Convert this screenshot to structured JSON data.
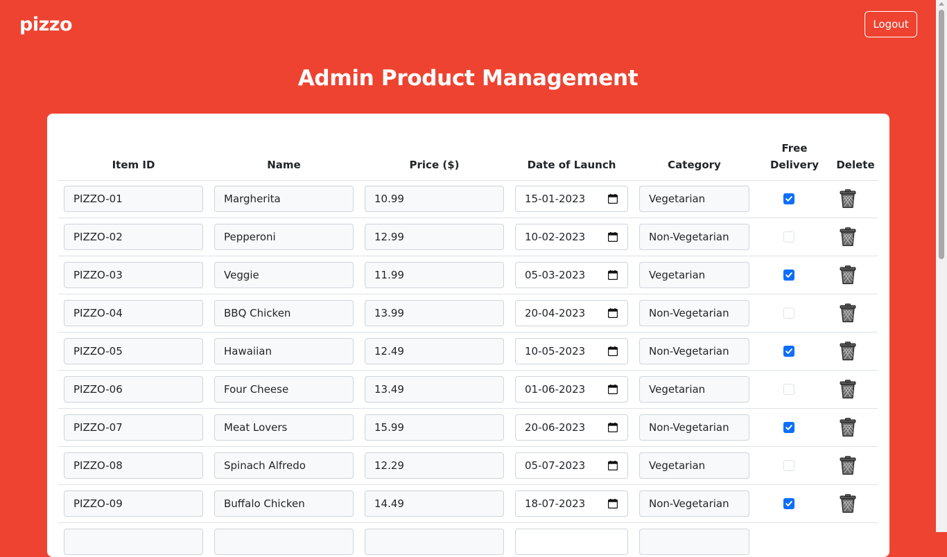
{
  "brand": "pizzo",
  "logout_label": "Logout",
  "page_title": "Admin Product Management",
  "columns": {
    "item_id": "Item ID",
    "name": "Name",
    "price": "Price ($)",
    "date": "Date of Launch",
    "category": "Category",
    "free_delivery": "Free Delivery",
    "delete": "Delete"
  },
  "colors": {
    "header_bg": "#ee4331",
    "checkbox_on": "#0d6efd"
  },
  "products": [
    {
      "id": "PIZZO-01",
      "name": "Margherita",
      "price": "10.99",
      "date": "15-01-2023",
      "category": "Vegetarian",
      "free_delivery": true
    },
    {
      "id": "PIZZO-02",
      "name": "Pepperoni",
      "price": "12.99",
      "date": "10-02-2023",
      "category": "Non-Vegetarian",
      "free_delivery": false
    },
    {
      "id": "PIZZO-03",
      "name": "Veggie",
      "price": "11.99",
      "date": "05-03-2023",
      "category": "Vegetarian",
      "free_delivery": true
    },
    {
      "id": "PIZZO-04",
      "name": "BBQ Chicken",
      "price": "13.99",
      "date": "20-04-2023",
      "category": "Non-Vegetarian",
      "free_delivery": false
    },
    {
      "id": "PIZZO-05",
      "name": "Hawaiian",
      "price": "12.49",
      "date": "10-05-2023",
      "category": "Non-Vegetarian",
      "free_delivery": true
    },
    {
      "id": "PIZZO-06",
      "name": "Four Cheese",
      "price": "13.49",
      "date": "01-06-2023",
      "category": "Vegetarian",
      "free_delivery": false
    },
    {
      "id": "PIZZO-07",
      "name": "Meat Lovers",
      "price": "15.99",
      "date": "20-06-2023",
      "category": "Non-Vegetarian",
      "free_delivery": true
    },
    {
      "id": "PIZZO-08",
      "name": "Spinach Alfredo",
      "price": "12.29",
      "date": "05-07-2023",
      "category": "Vegetarian",
      "free_delivery": false
    },
    {
      "id": "PIZZO-09",
      "name": "Buffalo Chicken",
      "price": "14.49",
      "date": "18-07-2023",
      "category": "Non-Vegetarian",
      "free_delivery": true
    }
  ]
}
